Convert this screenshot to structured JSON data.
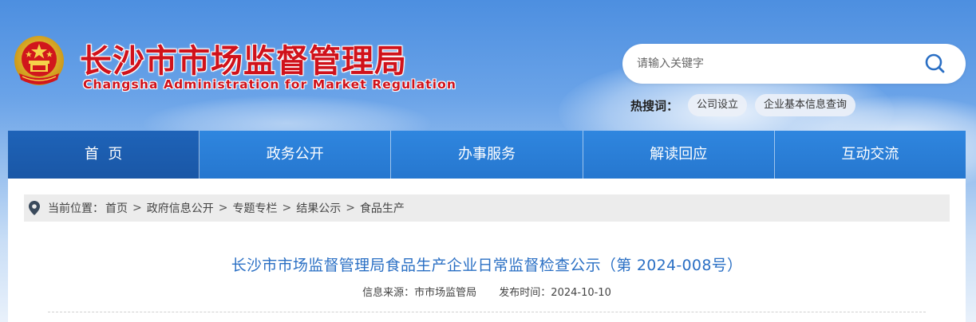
{
  "site": {
    "title": "长沙市市场监督管理局",
    "subtitle": "Changsha Administration for Market Regulation"
  },
  "search": {
    "placeholder": "请输入关键字",
    "value": ""
  },
  "hot_search": {
    "label": "热搜词：",
    "tags": [
      "公司设立",
      "企业基本信息查询"
    ]
  },
  "nav": {
    "items": [
      {
        "label": "首  页"
      },
      {
        "label": "政务公开"
      },
      {
        "label": "办事服务"
      },
      {
        "label": "解读回应"
      },
      {
        "label": "互动交流"
      }
    ]
  },
  "breadcrumb": {
    "prefix": "当前位置：",
    "separator": ">",
    "items": [
      "首页",
      "政府信息公开",
      "专题专栏",
      "结果公示",
      "食品生产"
    ]
  },
  "article": {
    "title": "长沙市市场监督管理局食品生产企业日常监督检查公示（第 2024-008号）",
    "source": "信息来源：市市场监管局",
    "date": "发布时间：2024-10-10"
  },
  "colors": {
    "brand_red": "#d0121b",
    "nav_blue": "#2a7fd8",
    "nav_active": "#1e63b8",
    "title_blue": "#2a6fc4"
  }
}
